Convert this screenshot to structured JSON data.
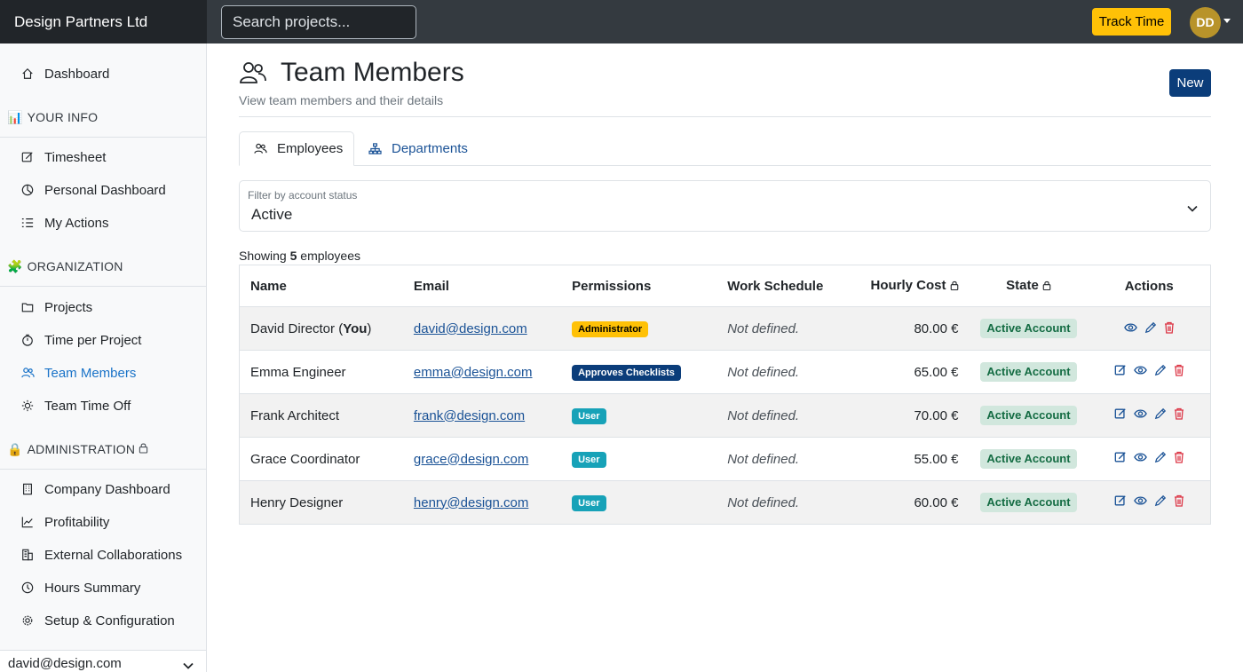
{
  "app": {
    "brand": "Design Partners Ltd",
    "search_placeholder": "Search projects...",
    "track_time_label": "Track Time",
    "avatar_initials": "DD"
  },
  "sidebar": {
    "dashboard": "Dashboard",
    "your_info": {
      "heading": "YOUR INFO",
      "emoji": "📊",
      "items": [
        "Timesheet",
        "Personal Dashboard",
        "My Actions"
      ]
    },
    "organization": {
      "heading": "ORGANIZATION",
      "emoji": "🧩",
      "items": [
        "Projects",
        "Time per Project",
        "Team Members",
        "Team Time Off"
      ]
    },
    "administration": {
      "heading": "ADMINISTRATION",
      "emoji": "🔒",
      "items": [
        "Company Dashboard",
        "Profitability",
        "External Collaborations",
        "Hours Summary",
        "Setup & Configuration"
      ]
    },
    "active_item": "Team Members",
    "user_email": "david@design.com"
  },
  "page": {
    "title": "Team Members",
    "subtitle": "View team members and their details",
    "new_label": "New",
    "tabs": [
      "Employees",
      "Departments"
    ],
    "filter": {
      "label": "Filter by account status",
      "value": "Active"
    },
    "showing_prefix": "Showing",
    "showing_count": "5",
    "showing_suffix": "employees"
  },
  "table": {
    "headers": [
      "Name",
      "Email",
      "Permissions",
      "Work Schedule",
      "Hourly Cost",
      "State",
      "Actions"
    ],
    "rows": [
      {
        "name": "David Director (",
        "name_you": "You",
        "name_close": ")",
        "email": "david@design.com",
        "permission": "Administrator",
        "schedule": "Not defined.",
        "cost": "80.00 €",
        "state": "Active Account"
      },
      {
        "name": "Emma Engineer",
        "email": "emma@design.com",
        "permission": "Approves Checklists",
        "schedule": "Not defined.",
        "cost": "65.00 €",
        "state": "Active Account"
      },
      {
        "name": "Frank Architect",
        "email": "frank@design.com",
        "permission": "User",
        "schedule": "Not defined.",
        "cost": "70.00 €",
        "state": "Active Account"
      },
      {
        "name": "Grace Coordinator",
        "email": "grace@design.com",
        "permission": "User",
        "schedule": "Not defined.",
        "cost": "55.00 €",
        "state": "Active Account"
      },
      {
        "name": "Henry Designer",
        "email": "henry@design.com",
        "permission": "User",
        "schedule": "Not defined.",
        "cost": "60.00 €",
        "state": "Active Account"
      }
    ]
  },
  "colors": {
    "administrator_badge": "#ffc107",
    "approves_badge": "#0b3d7a",
    "user_badge": "#17a2b8",
    "active_state_bg": "#d1e7dd",
    "active_state_text": "#146c43",
    "accent": "#1a73c8"
  }
}
